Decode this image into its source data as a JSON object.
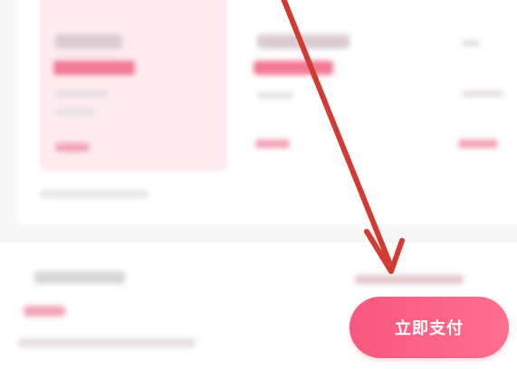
{
  "pay_button": {
    "label": "立即支付"
  },
  "icons": {
    "annotation_arrow": "arrow-down-right"
  },
  "colors": {
    "accent": "#f7577d",
    "annotation": "#d23a32"
  }
}
